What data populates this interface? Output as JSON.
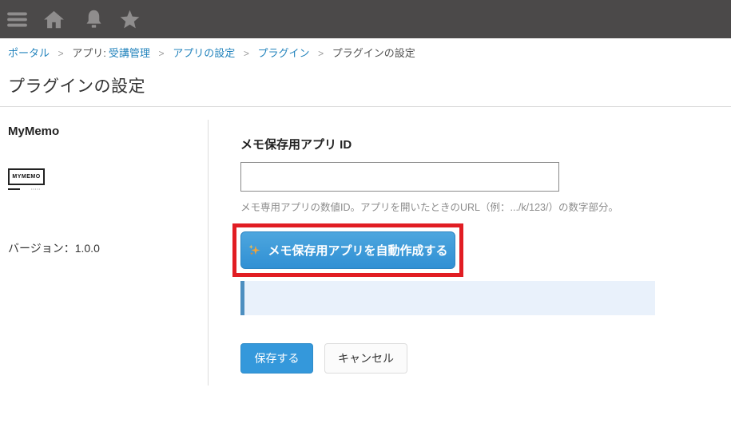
{
  "topbar": {
    "icons": [
      {
        "name": "hamburger-menu-icon"
      },
      {
        "name": "home-icon"
      },
      {
        "name": "bell-icon"
      },
      {
        "name": "star-icon"
      }
    ],
    "bg_color": "#4b4949",
    "icon_color": "#8f8d8d"
  },
  "breadcrumb": {
    "separator": ">",
    "items": [
      {
        "label": "ポータル"
      },
      {
        "prefix": "アプリ:",
        "label": "受講管理"
      },
      {
        "label": "アプリの設定"
      },
      {
        "label": "プラグイン"
      },
      {
        "label": "プラグインの設定"
      }
    ]
  },
  "page": {
    "title": "プラグインの設定"
  },
  "sidebar": {
    "plugin_name": "MyMemo",
    "logo_text": "MYMEMO",
    "version": "バージョン：1.0.0"
  },
  "main": {
    "field_label": "メモ保存用アプリ ID",
    "input_value": "",
    "helper_text": "メモ専用アプリの数値ID。アプリを開いたときのURL（例：.../k/123/）の数字部分。",
    "auto_create_label": "メモ保存用アプリを自動作成する",
    "auto_create_icon": "sparkles-icon",
    "message_text": "",
    "save_label": "保存する",
    "cancel_label": "キャンセル"
  },
  "colors": {
    "link_blue": "#2484bd",
    "button_blue": "#3498db",
    "auto_create_blue": "#3a97d6",
    "annotation_red": "#e11d23",
    "message_bg": "#e9f1fb",
    "message_border": "#4d8fc0",
    "topbar_bg": "#4b4949"
  }
}
